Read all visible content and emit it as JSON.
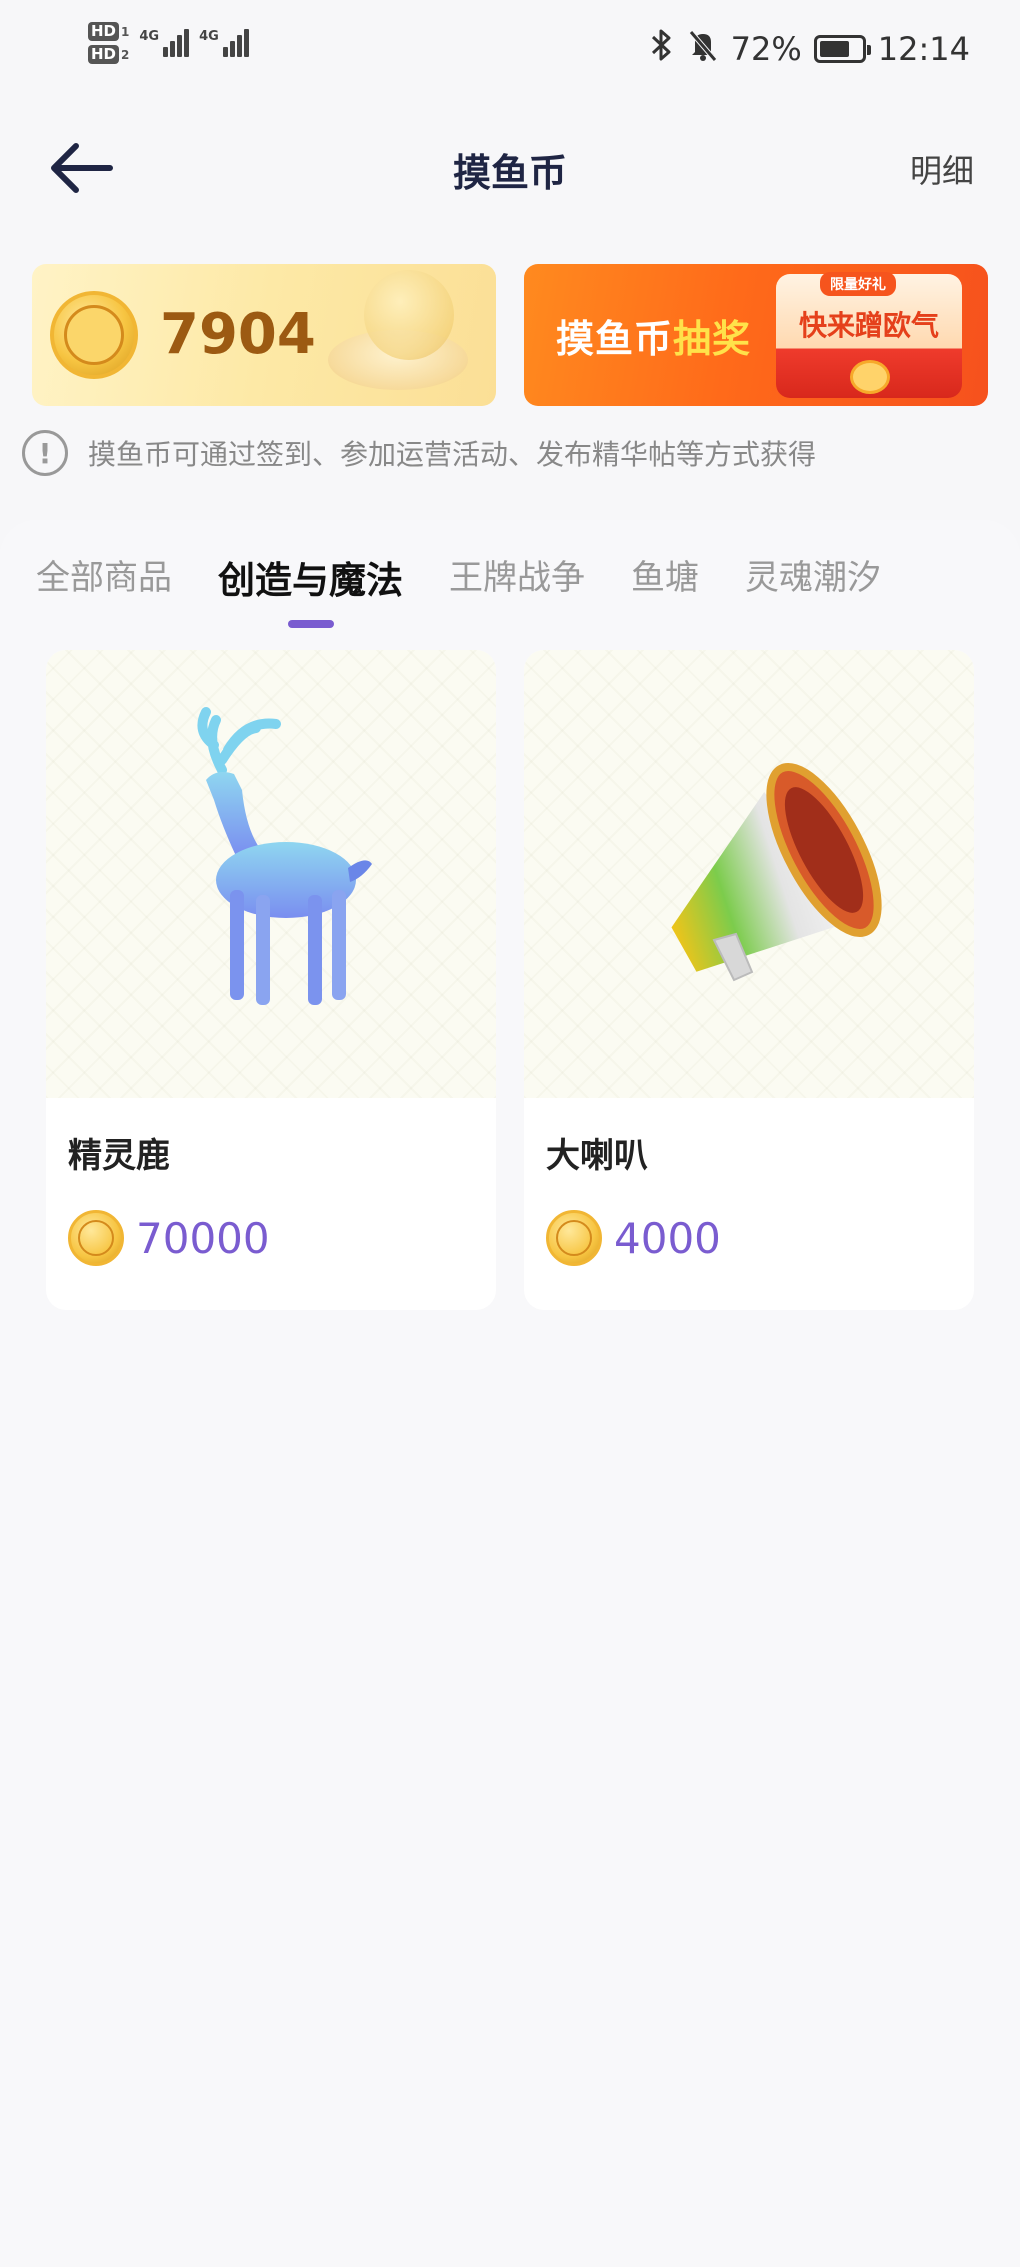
{
  "status_bar": {
    "network_1": "4G",
    "network_2": "4G",
    "hd_1": "HD",
    "hd_1_sub": "1",
    "hd_2": "HD",
    "hd_2_sub": "2",
    "battery_percent": "72%",
    "time": "12:14",
    "battery_level": 0.72
  },
  "header": {
    "title": "摸鱼币",
    "detail_label": "明细"
  },
  "balance": {
    "amount": "7904"
  },
  "lottery_banner": {
    "text_a": "摸鱼币",
    "text_b": "抽奖",
    "tag": "限量好礼",
    "cta": "快来蹭欧气"
  },
  "tip": {
    "text": "摸鱼币可通过签到、参加运营活动、发布精华帖等方式获得"
  },
  "tabs": [
    {
      "label": "全部商品",
      "active": false
    },
    {
      "label": "创造与魔法",
      "active": true
    },
    {
      "label": "王牌战争",
      "active": false
    },
    {
      "label": "鱼塘",
      "active": false
    },
    {
      "label": "灵魂潮汐",
      "active": false
    }
  ],
  "products": [
    {
      "name": "精灵鹿",
      "price": "70000",
      "image_icon": "deer-icon"
    },
    {
      "name": "大喇叭",
      "price": "4000",
      "image_icon": "megaphone-icon"
    }
  ],
  "colors": {
    "accent": "#7a5cd0",
    "title": "#1f2544",
    "coin_gold": "#f7c542",
    "banner_orange": "#ff6a1a"
  }
}
